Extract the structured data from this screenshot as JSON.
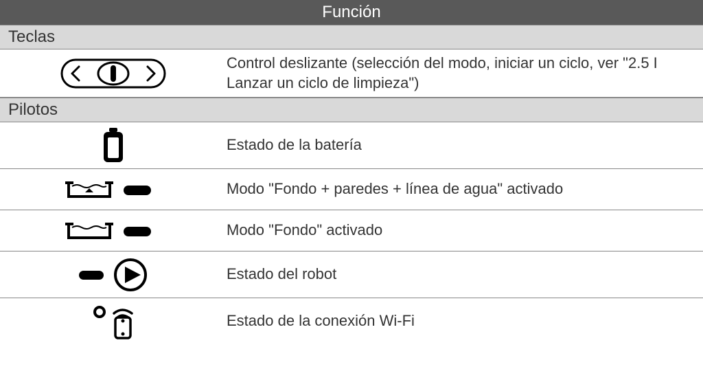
{
  "header": "Función",
  "sections": {
    "teclas": {
      "title": "Teclas",
      "rows": {
        "slider": "Control deslizante (selección del modo, iniciar un ciclo, ver \"2.5 I  Lanzar un ciclo de limpieza\")"
      }
    },
    "pilotos": {
      "title": "Pilotos",
      "rows": {
        "battery": "Estado de la batería",
        "mode_full": "Modo \"Fondo + paredes + línea de agua\" activado",
        "mode_floor": "Modo \"Fondo\" activado",
        "robot": "Estado del robot",
        "wifi": "Estado de la conexión Wi-Fi"
      }
    }
  }
}
